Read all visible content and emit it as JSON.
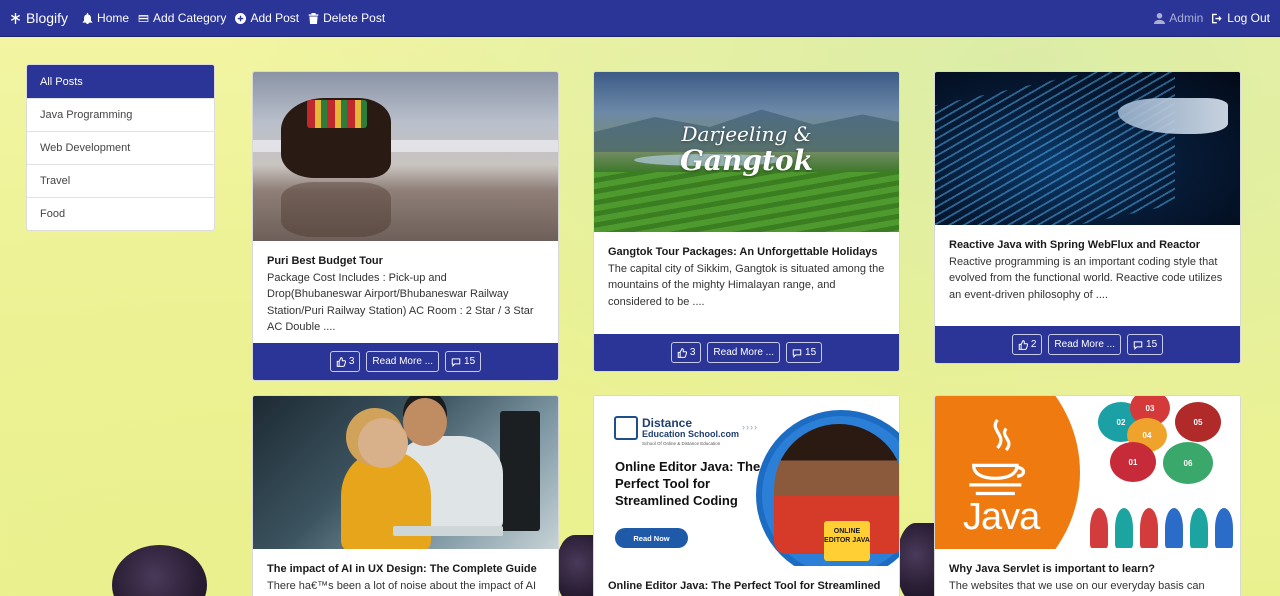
{
  "navbar": {
    "brand": "Blogify",
    "items": [
      {
        "label": "Home",
        "icon": "bell-icon"
      },
      {
        "label": "Add Category",
        "icon": "card-icon"
      },
      {
        "label": "Add Post",
        "icon": "plus-circle-icon"
      },
      {
        "label": "Delete Post",
        "icon": "trash-icon"
      }
    ],
    "admin": "Admin",
    "logout": "Log Out"
  },
  "sidebar": {
    "items": [
      {
        "label": "All Posts",
        "active": true
      },
      {
        "label": "Java Programming",
        "active": false
      },
      {
        "label": "Web Development",
        "active": false
      },
      {
        "label": "Travel",
        "active": false
      },
      {
        "label": "Food",
        "active": false
      }
    ]
  },
  "posts": [
    {
      "title": "Puri Best Budget Tour",
      "text": "Package Cost Includes : Pick-up and Drop(Bhubaneswar Airport/Bhubaneswar Railway Station/Puri Railway Station) AC Room : 2 Star / 3 Star AC Double ....",
      "likes": "3",
      "read_more": "Read More ...",
      "comments": "15"
    },
    {
      "title": "Gangtok Tour Packages: An Unforgettable Holidays",
      "text": "The capital city of Sikkim, Gangtok is situated among the mountains of the mighty Himalayan range, and considered to be ....",
      "likes": "3",
      "read_more": "Read More ...",
      "comments": "15",
      "image_text_1": "Darjeeling &",
      "image_text_2": "Gangtok"
    },
    {
      "title": "Reactive Java with Spring WebFlux and Reactor",
      "text": "Reactive programming is an important coding style that evolved from the functional world. Reactive code utilizes an event-driven philosophy of ....",
      "likes": "2",
      "read_more": "Read More ...",
      "comments": "15"
    },
    {
      "title": "The impact of AI in UX Design: The Complete Guide",
      "text": "There ha€™s been a lot of noise about the impact of AI on"
    },
    {
      "title": "Online Editor Java: The Perfect Tool for Streamlined",
      "image_logo_1": "Distance",
      "image_logo_2": "Education School.com",
      "image_logo_3": "School Of Online & Distance Education",
      "image_headline": "Online Editor Java: The Perfect Tool for Streamlined Coding",
      "image_button": "Read Now",
      "image_tag": "ONLINE EDITOR JAVA"
    },
    {
      "title": "Why Java Servlet is important to learn?",
      "text": "The websites that we use on our everyday basis can",
      "image_java": "Java",
      "image_bubbles": [
        "01",
        "02",
        "03",
        "04",
        "05",
        "06"
      ]
    }
  ],
  "colors": {
    "primary": "#2b3497",
    "card_bg": "#ffffff",
    "page_bg": "#eef39a"
  }
}
